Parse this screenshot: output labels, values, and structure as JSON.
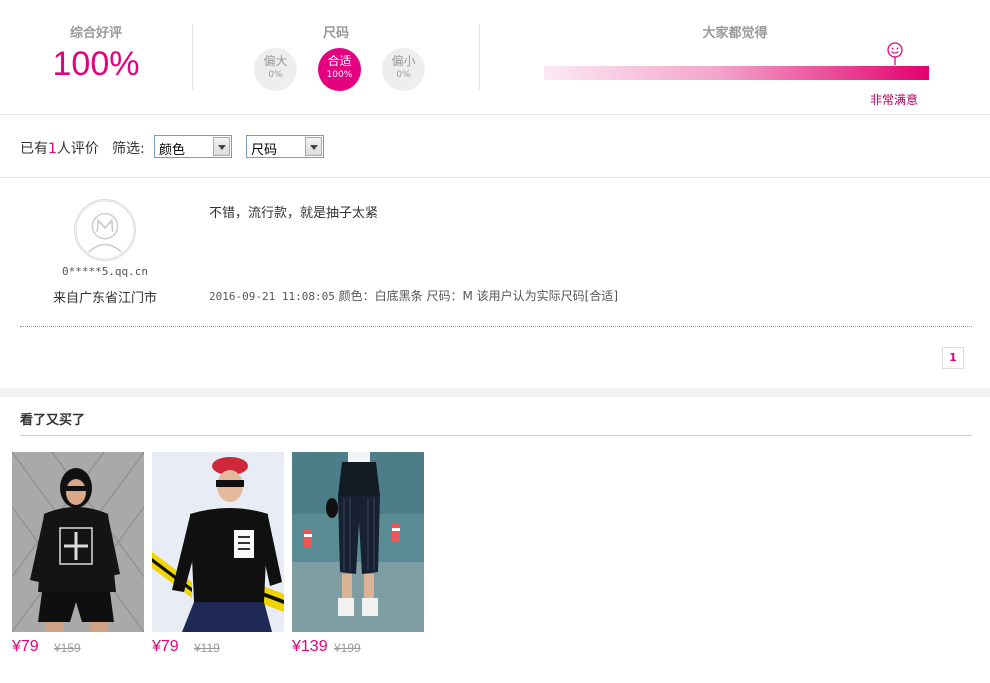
{
  "summary": {
    "rating_label": "综合好评",
    "rating_value": "100%",
    "size_label": "尺码",
    "size_options": [
      {
        "name": "偏大",
        "percent": "0%"
      },
      {
        "name": "合适",
        "percent": "100%",
        "active": true
      },
      {
        "name": "偏小",
        "percent": "0%"
      }
    ],
    "feel_label": "大家都觉得",
    "feel_result": "非常满意",
    "feel_level": 1.0
  },
  "filter": {
    "count_prefix": "已有",
    "count_value": "1",
    "count_suffix": "人评价",
    "filter_label": "筛选:",
    "color_select": "颜色",
    "size_select": "尺码"
  },
  "review": {
    "username": "0*****5.qq.cn",
    "location": "来自广东省江门市",
    "text": "不错，流行款，就是抽子太紧",
    "datetime": "2016-09-21 11:08:05",
    "meta": "颜色：白底黑条 尺码：M 该用户认为实际尺码[合适]"
  },
  "pagination": {
    "current": "1"
  },
  "recommend": {
    "title": "看了又买了",
    "products": [
      {
        "price": "¥79",
        "original_price": "¥159"
      },
      {
        "price": "¥79",
        "original_price": "¥119"
      },
      {
        "price": "¥139",
        "original_price": "¥199"
      }
    ]
  },
  "colors": {
    "accent": "#e4007f"
  }
}
